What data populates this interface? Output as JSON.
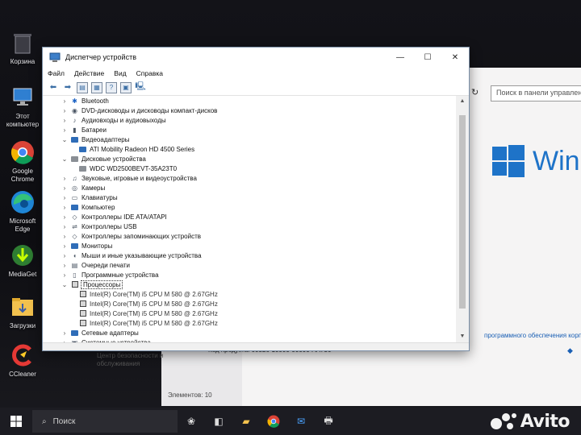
{
  "desktop": {
    "icons": [
      {
        "label": "Корзина",
        "icon": "recycle-bin-icon"
      },
      {
        "label": "Этот компьютер",
        "icon": "computer-icon"
      },
      {
        "label": "Google Chrome",
        "icon": "chrome-icon"
      },
      {
        "label": "Microsoft Edge",
        "icon": "edge-icon"
      },
      {
        "label": "MediaGet",
        "icon": "mediaget-icon"
      },
      {
        "label": "Загрузки",
        "icon": "folder-downloads-icon"
      },
      {
        "label": "CCleaner",
        "icon": "ccleaner-icon"
      }
    ]
  },
  "control_panel": {
    "search_placeholder": "Поиск в панели управления",
    "windows_text": "Win",
    "license_link": "программного обеспечения корпорации",
    "product_code": "Код продукта: 00326-10000-00000-AA736",
    "security_center": "Центр безопасности и обслуживания",
    "items_count": "Элементов: 10"
  },
  "window": {
    "title": "Диспетчер устройств",
    "menu": [
      "Файл",
      "Действие",
      "Вид",
      "Справка"
    ],
    "tree": [
      {
        "label": "Bluetooth",
        "icon": "bluetooth-icon",
        "expanded": false,
        "level": 0
      },
      {
        "label": "DVD-дисководы и дисководы компакт-дисков",
        "icon": "dvd-drive-icon",
        "expanded": false,
        "level": 0
      },
      {
        "label": "Аудиовходы и аудиовыходы",
        "icon": "audio-icon",
        "expanded": false,
        "level": 0
      },
      {
        "label": "Батареи",
        "icon": "battery-icon",
        "expanded": false,
        "level": 0
      },
      {
        "label": "Видеоадаптеры",
        "icon": "display-adapter-icon",
        "expanded": true,
        "level": 0
      },
      {
        "label": "ATI Mobility Radeon HD 4500 Series",
        "icon": "display-adapter-icon",
        "level": 1
      },
      {
        "label": "Дисковые устройства",
        "icon": "disk-drive-icon",
        "expanded": true,
        "level": 0
      },
      {
        "label": "WDC WD2500BEVT-35A23T0",
        "icon": "disk-drive-icon",
        "level": 1
      },
      {
        "label": "Звуковые, игровые и видеоустройства",
        "icon": "speaker-icon",
        "expanded": false,
        "level": 0
      },
      {
        "label": "Камеры",
        "icon": "camera-icon",
        "expanded": false,
        "level": 0
      },
      {
        "label": "Клавиатуры",
        "icon": "keyboard-icon",
        "expanded": false,
        "level": 0
      },
      {
        "label": "Компьютер",
        "icon": "computer-icon",
        "expanded": false,
        "level": 0
      },
      {
        "label": "Контроллеры IDE ATA/ATAPI",
        "icon": "ide-controller-icon",
        "expanded": false,
        "level": 0
      },
      {
        "label": "Контроллеры USB",
        "icon": "usb-icon",
        "expanded": false,
        "level": 0
      },
      {
        "label": "Контроллеры запоминающих устройств",
        "icon": "storage-controller-icon",
        "expanded": false,
        "level": 0
      },
      {
        "label": "Мониторы",
        "icon": "monitor-icon",
        "expanded": false,
        "level": 0
      },
      {
        "label": "Мыши и иные указывающие устройства",
        "icon": "mouse-icon",
        "expanded": false,
        "level": 0
      },
      {
        "label": "Очереди печати",
        "icon": "printer-icon",
        "expanded": false,
        "level": 0
      },
      {
        "label": "Программные устройства",
        "icon": "software-device-icon",
        "expanded": false,
        "level": 0
      },
      {
        "label": "Процессоры",
        "icon": "processor-icon",
        "expanded": true,
        "level": 0,
        "selected": true
      },
      {
        "label": "Intel(R) Core(TM) i5 CPU       M 580  @ 2.67GHz",
        "icon": "processor-icon",
        "level": 1
      },
      {
        "label": "Intel(R) Core(TM) i5 CPU       M 580  @ 2.67GHz",
        "icon": "processor-icon",
        "level": 1
      },
      {
        "label": "Intel(R) Core(TM) i5 CPU       M 580  @ 2.67GHz",
        "icon": "processor-icon",
        "level": 1
      },
      {
        "label": "Intel(R) Core(TM) i5 CPU       M 580  @ 2.67GHz",
        "icon": "processor-icon",
        "level": 1
      },
      {
        "label": "Сетевые адаптеры",
        "icon": "network-adapter-icon",
        "expanded": false,
        "level": 0
      },
      {
        "label": "Системные устройства",
        "icon": "system-device-icon",
        "expanded": false,
        "level": 0
      }
    ]
  },
  "taskbar": {
    "search_placeholder": "Поиск",
    "apps": [
      "photo-viewer-icon",
      "camera-app-icon",
      "file-explorer-icon",
      "chrome-icon",
      "mail-icon",
      "device-manager-icon"
    ]
  },
  "watermark": {
    "text": "Avito"
  }
}
